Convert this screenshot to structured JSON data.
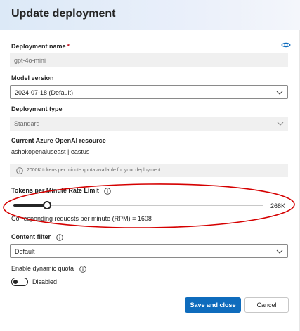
{
  "header": {
    "title": "Update deployment"
  },
  "deployment_name": {
    "label": "Deployment name",
    "required_mark": "*",
    "value": "gpt-4o-mini",
    "icon": "eye-icon"
  },
  "model_version": {
    "label": "Model version",
    "selected": "2024-07-18 (Default)"
  },
  "deployment_type": {
    "label": "Deployment type",
    "selected": "Standard"
  },
  "resource": {
    "label": "Current Azure OpenAI resource",
    "value": "ashokopenaiuseast | eastus"
  },
  "quota_info": {
    "text": "2000K tokens per minute quota available for your deployment"
  },
  "tpm": {
    "label": "Tokens per Minute Rate Limit",
    "slider_value_fraction": 0.134,
    "max_label": "268K",
    "rpm_text": "Corresponding requests per minute (RPM) = 1608"
  },
  "content_filter": {
    "label": "Content filter",
    "selected": "Default"
  },
  "dynamic_quota": {
    "label": "Enable dynamic quota",
    "toggle_state": "Disabled"
  },
  "footer": {
    "save_label": "Save and close",
    "cancel_label": "Cancel"
  },
  "colors": {
    "primary": "#0f6cbd",
    "annotation": "#d50000",
    "required": "#c50f1f"
  }
}
